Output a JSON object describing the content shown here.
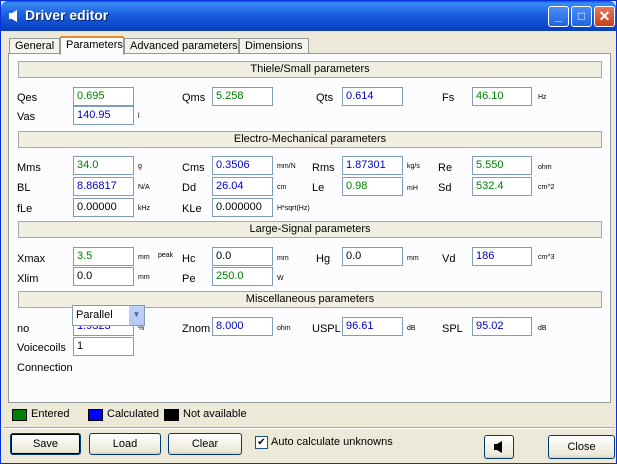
{
  "window": {
    "title": "Driver editor",
    "minimize": "_",
    "maximize": "□",
    "close": "✕",
    "app_icon": "speaker-icon"
  },
  "tabs": [
    "General",
    "Parameters",
    "Advanced parameters",
    "Dimensions"
  ],
  "active_tab": "Parameters",
  "sections": {
    "thiele": "Thiele/Small parameters",
    "electro": "Electro-Mechanical parameters",
    "large": "Large-Signal parameters",
    "misc": "Miscellaneous parameters"
  },
  "params": {
    "qes": {
      "label": "Qes",
      "value": "0.695"
    },
    "qms": {
      "label": "Qms",
      "value": "5.258"
    },
    "qts": {
      "label": "Qts",
      "value": "0.614"
    },
    "fs": {
      "label": "Fs",
      "value": "46.10",
      "unit": "Hz"
    },
    "vas": {
      "label": "Vas",
      "value": "140.95",
      "unit": "l"
    },
    "mms": {
      "label": "Mms",
      "value": "34.0",
      "unit": "g"
    },
    "cms": {
      "label": "Cms",
      "value": "0.3506",
      "unit": "mm/N"
    },
    "rms": {
      "label": "Rms",
      "value": "1.87301",
      "unit": "kg/s"
    },
    "re": {
      "label": "Re",
      "value": "5.550",
      "unit": "ohm"
    },
    "bl": {
      "label": "BL",
      "value": "8.86817",
      "unit": "N/A"
    },
    "dd": {
      "label": "Dd",
      "value": "26.04",
      "unit": "cm"
    },
    "le": {
      "label": "Le",
      "value": "0.98",
      "unit": "mH"
    },
    "sd": {
      "label": "Sd",
      "value": "532.4",
      "unit": "cm^2"
    },
    "fle": {
      "label": "fLe",
      "value": "0.00000",
      "unit": "kHz"
    },
    "kle": {
      "label": "KLe",
      "value": "0.000000",
      "unit": "H*sqrt(Hz)"
    },
    "xmax": {
      "label": "Xmax",
      "value": "3.5",
      "unit": "mm",
      "unit2": "peak"
    },
    "hc": {
      "label": "Hc",
      "value": "0.0",
      "unit": "mm"
    },
    "hg": {
      "label": "Hg",
      "value": "0.0",
      "unit": "mm"
    },
    "vd": {
      "label": "Vd",
      "value": "186",
      "unit": "cm^3"
    },
    "xlim": {
      "label": "Xlim",
      "value": "0.0",
      "unit": "mm"
    },
    "pe": {
      "label": "Pe",
      "value": "250.0",
      "unit": "W"
    },
    "no": {
      "label": "no",
      "value": "1.9323",
      "unit": "%"
    },
    "znom": {
      "label": "Znom",
      "value": "8.000",
      "unit": "ohm"
    },
    "uspl": {
      "label": "USPL",
      "value": "96.61",
      "unit": "dB"
    },
    "spl": {
      "label": "SPL",
      "value": "95.02",
      "unit": "dB"
    },
    "voicecoils": {
      "label": "Voicecoils",
      "value": "1"
    },
    "connection": {
      "label": "Connection",
      "value": "Parallel"
    }
  },
  "legend": {
    "entered": "Entered",
    "calculated": "Calculated",
    "not_available": "Not available",
    "colors": {
      "entered": "#008000",
      "calculated": "#0000ff",
      "not_available": "#000000"
    }
  },
  "buttons": {
    "save": "Save",
    "load": "Load",
    "clear": "Clear",
    "auto_calc": "Auto calculate unknowns",
    "auto_calc_checked": "✔",
    "speaker": "speaker-icon",
    "close": "Close"
  }
}
